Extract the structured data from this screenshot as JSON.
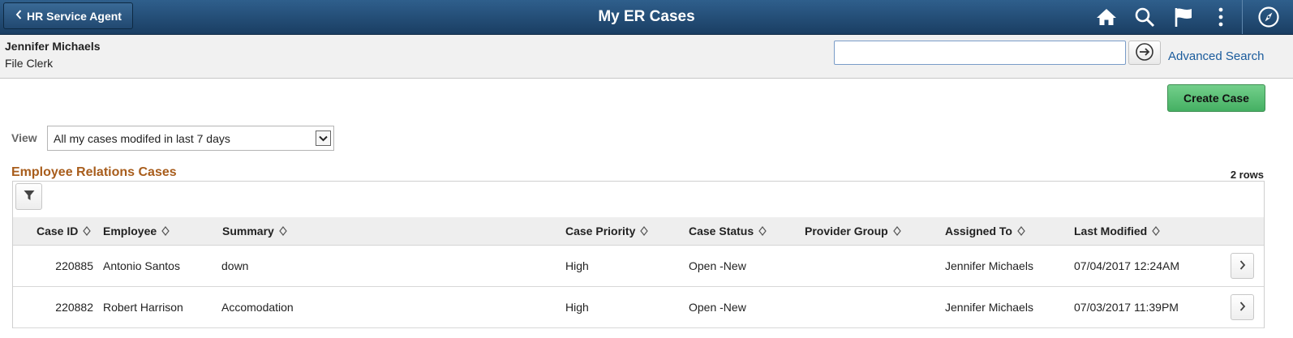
{
  "banner": {
    "back_label": "HR Service Agent",
    "title": "My ER Cases",
    "icons": [
      "home-icon",
      "search-icon",
      "flag-icon",
      "more-vertical-icon",
      "navbar-compass-icon"
    ]
  },
  "context": {
    "user_name": "Jennifer Michaels",
    "user_role": "File Clerk",
    "search_value": "",
    "advanced_search": "Advanced Search"
  },
  "actions": {
    "create_case": "Create Case"
  },
  "view": {
    "label": "View",
    "selected": "All my cases modifed in last 7 days"
  },
  "grid": {
    "title": "Employee Relations Cases",
    "row_count": "2 rows",
    "columns": [
      "Case ID",
      "Employee",
      "Summary",
      "Case Priority",
      "Case Status",
      "Provider Group",
      "Assigned To",
      "Last Modified"
    ],
    "rows": [
      {
        "case_id": "220885",
        "employee": "Antonio Santos",
        "summary": "down",
        "priority": "High",
        "status": "Open -New",
        "provider_group": "",
        "assigned_to": "Jennifer Michaels",
        "last_modified": "07/04/2017 12:24AM"
      },
      {
        "case_id": "220882",
        "employee": "Robert Harrison",
        "summary": "Accomodation",
        "priority": "High",
        "status": "Open -New",
        "provider_group": "",
        "assigned_to": "Jennifer Michaels",
        "last_modified": "07/03/2017 11:39PM"
      }
    ]
  },
  "colors": {
    "banner": "#1f4a72",
    "accent": "#a85d1c",
    "link": "#1a5b9c",
    "create_button": "#52b86d"
  }
}
